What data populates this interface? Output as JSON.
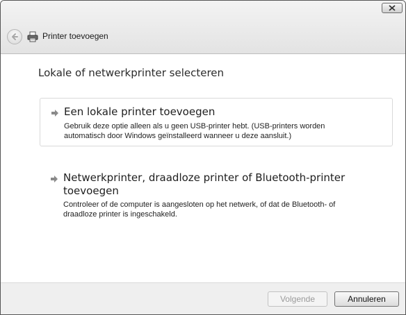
{
  "window": {
    "title": "Printer toevoegen"
  },
  "page": {
    "heading": "Lokale of netwerkprinter selecteren"
  },
  "options": [
    {
      "title": "Een lokale printer toevoegen",
      "description_line1": "Gebruik deze optie alleen als u geen USB-printer hebt. (USB-printers worden",
      "description_line2": "automatisch door Windows geïnstalleerd wanneer u deze aansluit.)"
    },
    {
      "title_line1": "Netwerkprinter, draadloze printer of Bluetooth-printer",
      "title_line2": "toevoegen",
      "description_line1": "Controleer of de computer is aangesloten op het netwerk, of dat de Bluetooth- of",
      "description_line2": "draadloze printer is ingeschakeld."
    }
  ],
  "footer": {
    "next_label": "Volgende",
    "cancel_label": "Annuleren"
  },
  "icons": {
    "close": "close-icon",
    "back": "back-arrow-icon",
    "printer": "printer-icon",
    "option_arrow": "green-arrow-icon"
  },
  "colors": {
    "footer_bg": "#efefef",
    "disabled_text": "#9a9a9a"
  }
}
